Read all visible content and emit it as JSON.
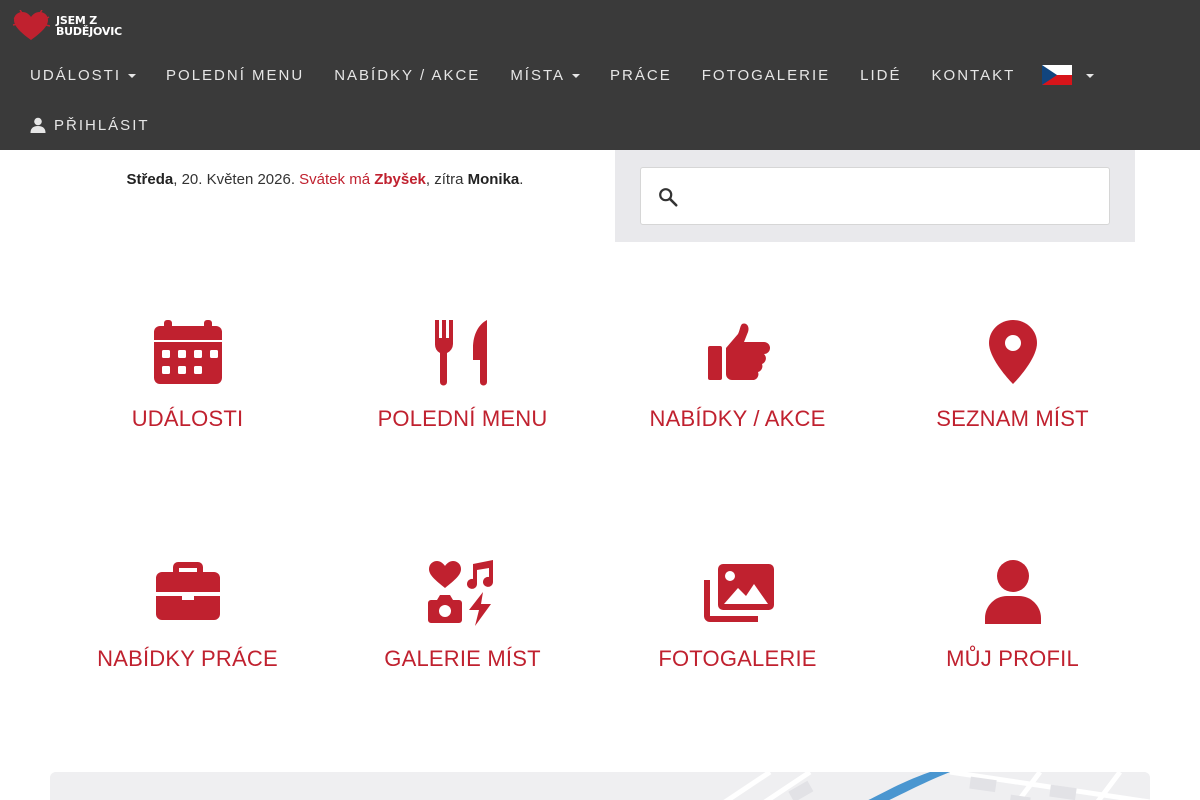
{
  "brand": {
    "line1": "JSEM Z",
    "line2": "BUDĚJOVIC",
    "icon": "heart-logo-icon",
    "color": "#c0212f"
  },
  "nav": {
    "items": [
      {
        "label": "UDÁLOSTI",
        "dropdown": true
      },
      {
        "label": "POLEDNÍ MENU",
        "dropdown": false
      },
      {
        "label": "NABÍDKY / AKCE",
        "dropdown": false
      },
      {
        "label": "MÍSTA",
        "dropdown": true
      },
      {
        "label": "PRÁCE",
        "dropdown": false
      },
      {
        "label": "FOTOGALERIE",
        "dropdown": false
      },
      {
        "label": "LIDÉ",
        "dropdown": false
      },
      {
        "label": "KONTAKT",
        "dropdown": false
      }
    ],
    "language_icon": "czech-flag-icon",
    "login_label": "PŘIHLÁSIT",
    "background": "#3a3a3a"
  },
  "date_line": {
    "weekday": "Středa",
    "date": ", 20. Květen 2026. ",
    "nameday_prefix": "Svátek má ",
    "nameday_today": "Zbyšek",
    "tomorrow_prefix": ", zítra ",
    "nameday_tomorrow": "Monika",
    "end": "."
  },
  "search": {
    "placeholder": "",
    "value": ""
  },
  "tiles": [
    {
      "label": "UDÁLOSTI",
      "icon": "calendar-icon"
    },
    {
      "label": "POLEDNÍ MENU",
      "icon": "fork-knife-icon"
    },
    {
      "label": "NABÍDKY / AKCE",
      "icon": "thumbs-up-icon"
    },
    {
      "label": "SEZNAM MÍST",
      "icon": "map-pin-icon"
    },
    {
      "label": "NABÍDKY PRÁCE",
      "icon": "briefcase-icon"
    },
    {
      "label": "GALERIE MÍST",
      "icon": "heart-music-camera-bolt-icon"
    },
    {
      "label": "FOTOGALERIE",
      "icon": "photo-gallery-icon"
    },
    {
      "label": "MŮJ PROFIL",
      "icon": "user-icon"
    }
  ],
  "accent_color": "#c0212f"
}
